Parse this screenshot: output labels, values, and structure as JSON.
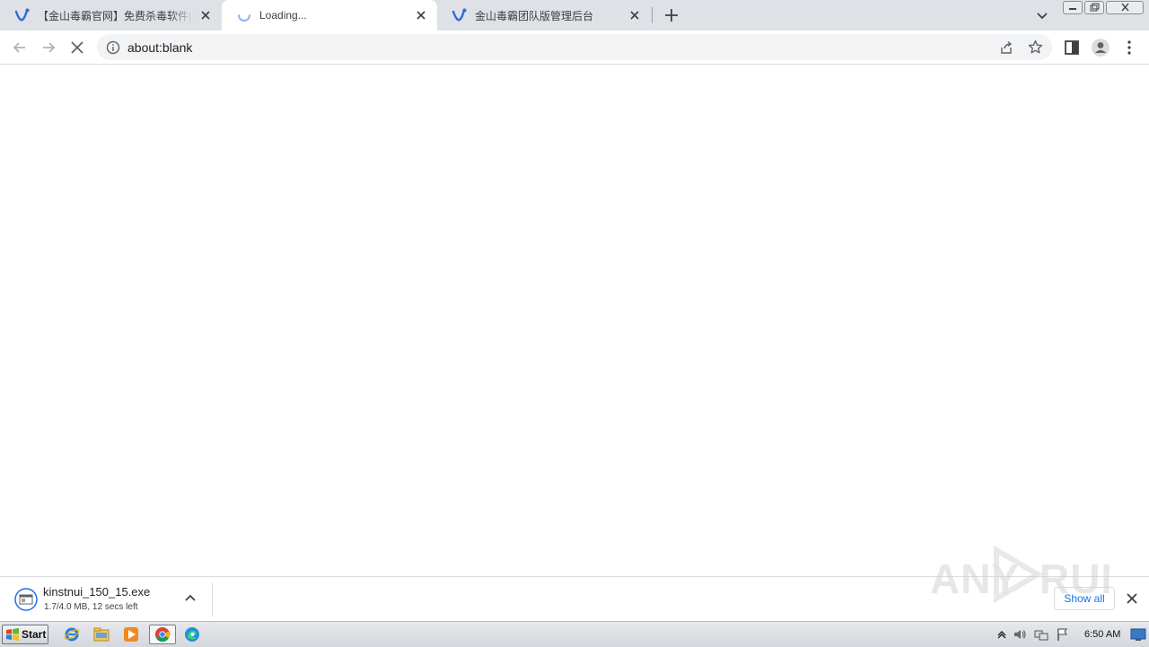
{
  "tabs": [
    {
      "title": "【金山毒霸官网】免费杀毒软件|电脑杀毒",
      "favicon": "kingsoft-logo-icon",
      "active": false
    },
    {
      "title": "Loading...",
      "favicon": "loading-spinner-icon",
      "active": true
    },
    {
      "title": "金山毒霸团队版管理后台",
      "favicon": "kingsoft-logo-icon",
      "active": false
    }
  ],
  "toolbar": {
    "url": "about:blank",
    "icons": [
      "back-icon",
      "forward-icon",
      "stop-icon",
      "info-icon",
      "share-icon",
      "bookmark-star-icon",
      "side-panel-icon",
      "profile-icon",
      "menu-icon"
    ]
  },
  "download_shelf": {
    "file_name": "kinstnui_150_15.exe",
    "status": "1.7/4.0 MB, 12 secs left",
    "show_all_label": "Show all"
  },
  "watermark": {
    "text": "ANY RUN"
  },
  "taskbar": {
    "start_label": "Start",
    "pinned": [
      "internet-explorer-icon",
      "file-explorer-icon",
      "media-player-icon",
      "chrome-icon",
      "edge-icon"
    ],
    "clock": "6:50 AM"
  },
  "colors": {
    "tabstrip": "#dee1e6",
    "accent": "#1a73e8",
    "omnibox": "#f1f3f4"
  }
}
